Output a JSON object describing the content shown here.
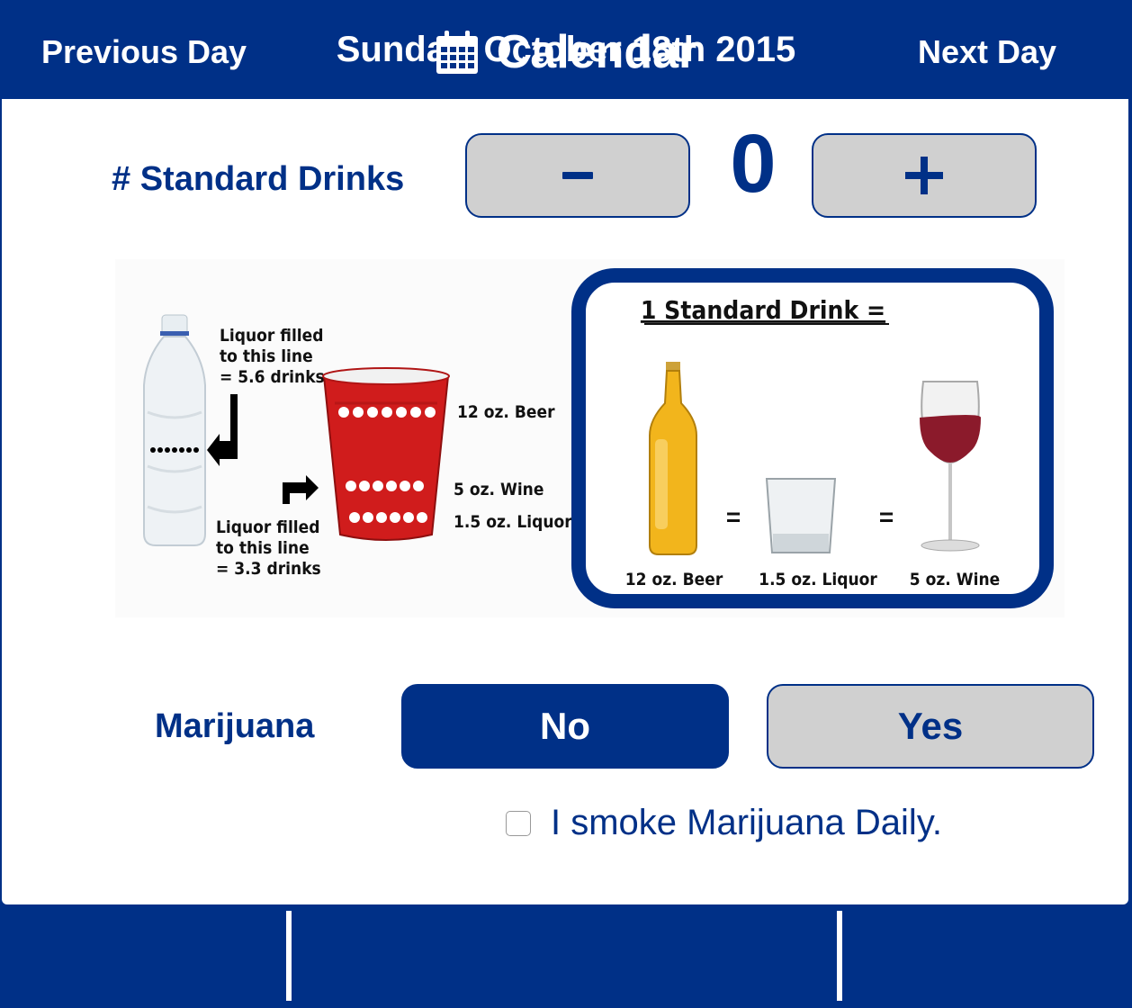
{
  "header": {
    "date": "Sunday, October 18th 2015"
  },
  "drinks": {
    "label": "# Standard Drinks",
    "count": "0",
    "minus_label": "-",
    "plus_label": "+"
  },
  "infographic": {
    "bottle_upper_note": [
      "Liquor filled",
      "to this line",
      "= 5.6 drinks"
    ],
    "bottle_lower_note": [
      "Liquor filled",
      "to this line",
      "= 3.3 drinks"
    ],
    "cup_labels": [
      "12 oz. Beer",
      "5 oz. Wine",
      "1.5 oz. Liquor"
    ],
    "box_title": "1 Standard Drink =",
    "box_items": [
      "12 oz. Beer",
      "1.5 oz. Liquor",
      "5 oz. Wine"
    ],
    "equals": "="
  },
  "marijuana": {
    "label": "Marijuana",
    "no_label": "No",
    "yes_label": "Yes",
    "selected": "No",
    "daily_label": "I smoke Marijuana Daily.",
    "daily_checked": false
  },
  "footer": {
    "previous": "Previous Day",
    "calendar": "Calendar",
    "next": "Next Day"
  },
  "colors": {
    "primary": "#003087",
    "button_gray": "#d0d0d0",
    "cup_red": "#d01c1c"
  }
}
